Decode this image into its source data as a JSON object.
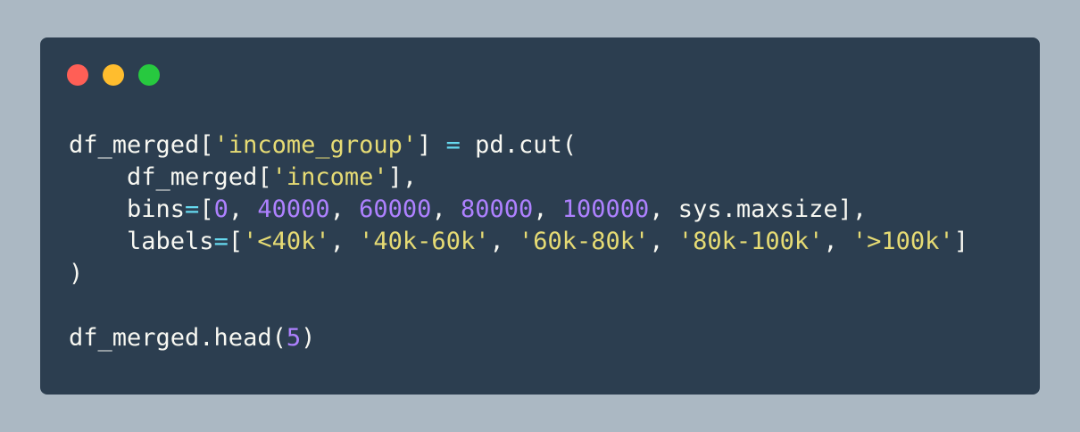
{
  "window": {
    "buttons": {
      "close": "close",
      "minimize": "minimize",
      "zoom": "zoom"
    }
  },
  "code": {
    "language": "python",
    "colors": {
      "background": "#2c3e50",
      "page_background": "#abb8c3",
      "text": "#f8f8f2",
      "string": "#e6db74",
      "number": "#ae81ff",
      "operator": "#66d9ef"
    },
    "lines": [
      [
        {
          "t": "df_merged[",
          "k": "p"
        },
        {
          "t": "'income_group'",
          "k": "s"
        },
        {
          "t": "] ",
          "k": "p"
        },
        {
          "t": "=",
          "k": "o"
        },
        {
          "t": " pd.cut(",
          "k": "p"
        }
      ],
      [
        {
          "t": "    df_merged[",
          "k": "p"
        },
        {
          "t": "'income'",
          "k": "s"
        },
        {
          "t": "],",
          "k": "p"
        }
      ],
      [
        {
          "t": "    bins",
          "k": "p"
        },
        {
          "t": "=",
          "k": "o"
        },
        {
          "t": "[",
          "k": "p"
        },
        {
          "t": "0",
          "k": "n"
        },
        {
          "t": ", ",
          "k": "p"
        },
        {
          "t": "40000",
          "k": "n"
        },
        {
          "t": ", ",
          "k": "p"
        },
        {
          "t": "60000",
          "k": "n"
        },
        {
          "t": ", ",
          "k": "p"
        },
        {
          "t": "80000",
          "k": "n"
        },
        {
          "t": ", ",
          "k": "p"
        },
        {
          "t": "100000",
          "k": "n"
        },
        {
          "t": ", sys.maxsize],",
          "k": "p"
        }
      ],
      [
        {
          "t": "    labels",
          "k": "p"
        },
        {
          "t": "=",
          "k": "o"
        },
        {
          "t": "[",
          "k": "p"
        },
        {
          "t": "'<40k'",
          "k": "s"
        },
        {
          "t": ", ",
          "k": "p"
        },
        {
          "t": "'40k-60k'",
          "k": "s"
        },
        {
          "t": ", ",
          "k": "p"
        },
        {
          "t": "'60k-80k'",
          "k": "s"
        },
        {
          "t": ", ",
          "k": "p"
        },
        {
          "t": "'80k-100k'",
          "k": "s"
        },
        {
          "t": ", ",
          "k": "p"
        },
        {
          "t": "'>100k'",
          "k": "s"
        },
        {
          "t": "]",
          "k": "p"
        }
      ],
      [
        {
          "t": ")",
          "k": "p"
        }
      ],
      [],
      [
        {
          "t": "df_merged.head(",
          "k": "p"
        },
        {
          "t": "5",
          "k": "n"
        },
        {
          "t": ")",
          "k": "p"
        }
      ]
    ]
  }
}
